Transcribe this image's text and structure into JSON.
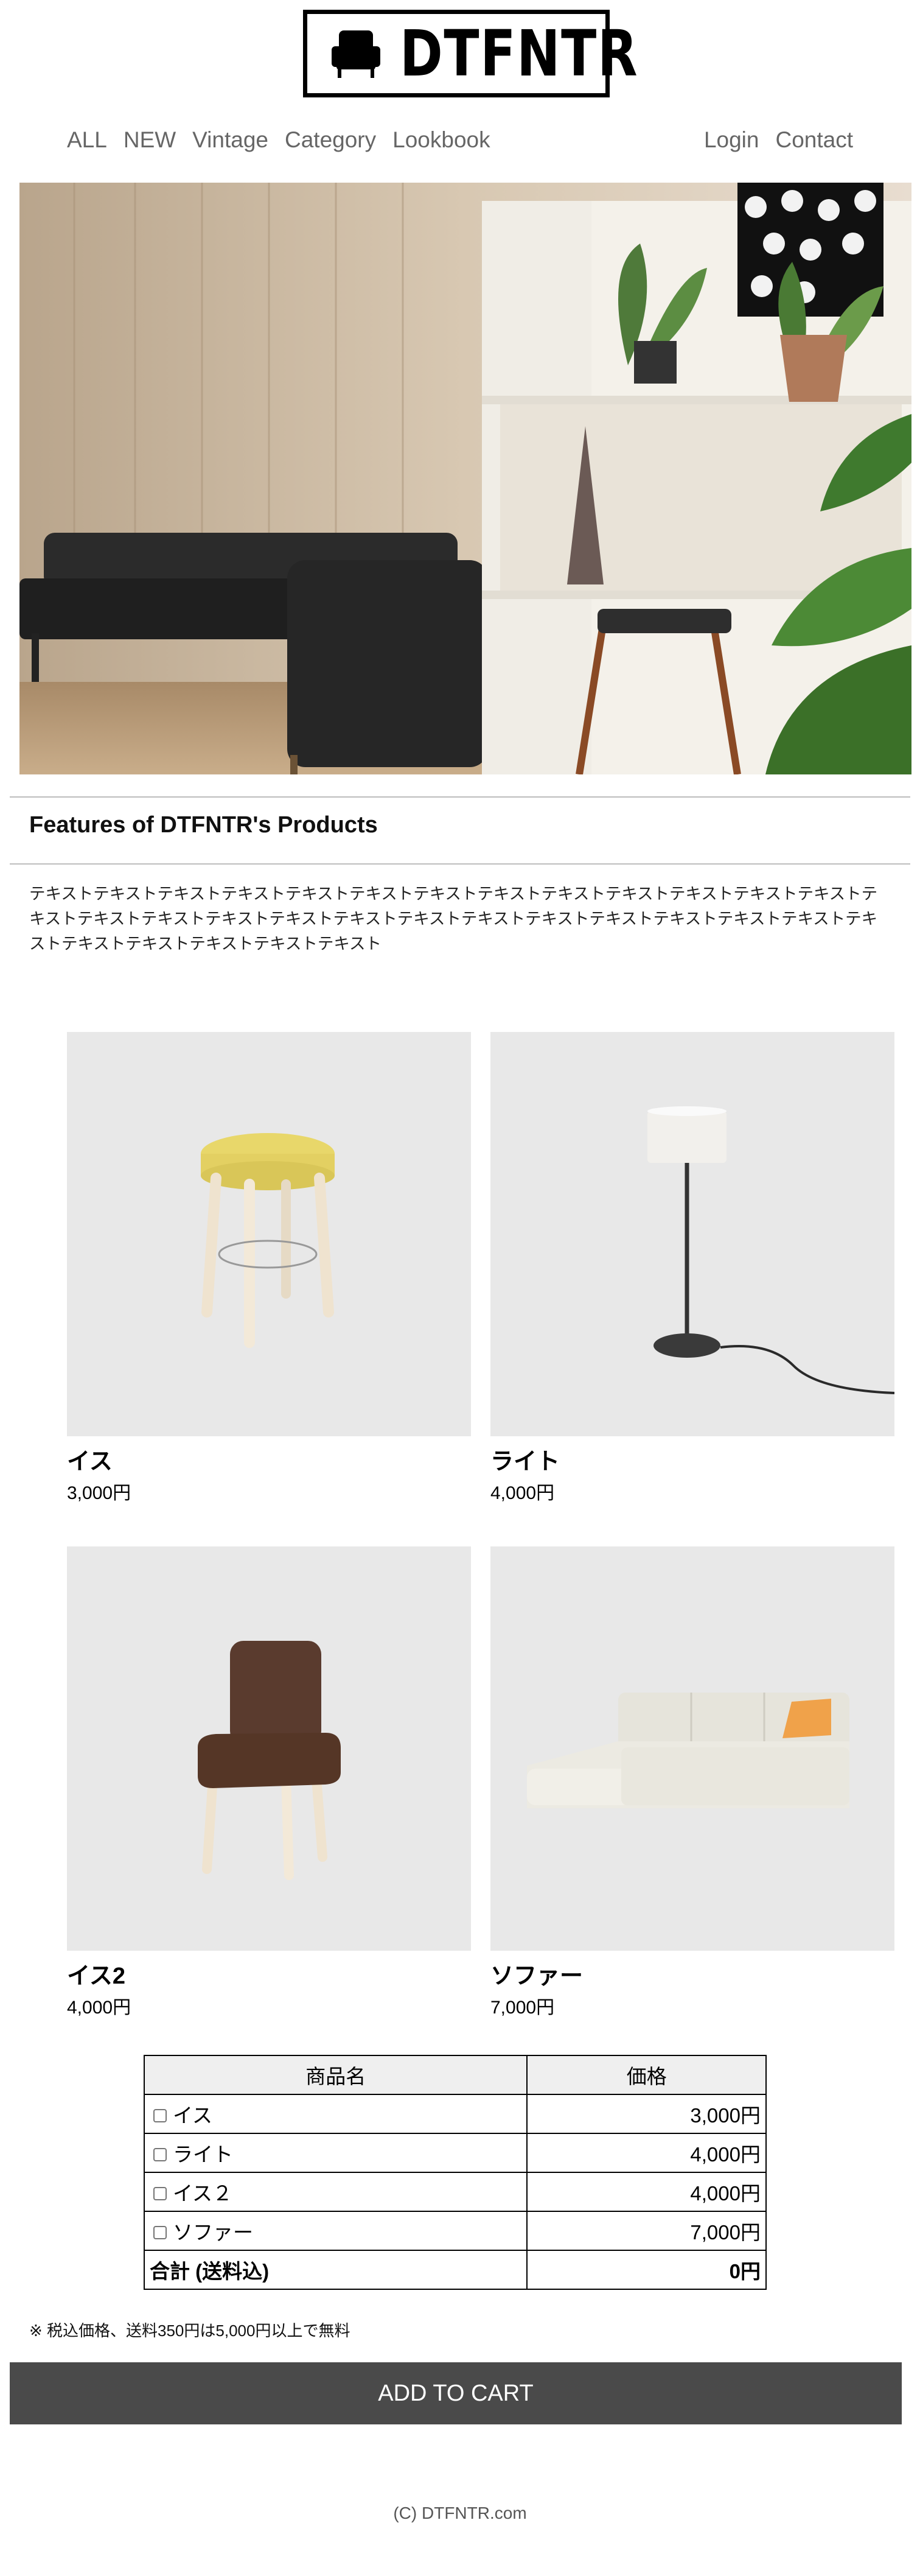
{
  "brand": {
    "name": "DTFNTR",
    "logo_icon": "armchair-icon"
  },
  "nav": {
    "left": [
      "ALL",
      "NEW",
      "Vintage",
      "Category",
      "Lookbook"
    ],
    "right": [
      "Login",
      "Contact"
    ]
  },
  "features": {
    "title": "Features of DTFNTR's Products",
    "body": "テキストテキストテキストテキストテキストテキストテキストテキストテキストテキストテキストテキストテキストテキストテキストテキストテキストテキストテキストテキストテキストテキストテキストテキストテキストテキストテキストテキストテキストテキストテキストテキスト"
  },
  "products": [
    {
      "name": "イス",
      "price": "3,000円"
    },
    {
      "name": "ライト",
      "price": "4,000円"
    },
    {
      "name": "イス2",
      "price": "4,000円"
    },
    {
      "name": "ソファー",
      "price": "7,000円"
    }
  ],
  "table": {
    "headers": [
      "商品名",
      "価格"
    ],
    "rows": [
      {
        "item": "イス",
        "price": "3,000円",
        "checked": false
      },
      {
        "item": "ライト",
        "price": "4,000円",
        "checked": false
      },
      {
        "item": "イス２",
        "price": "4,000円",
        "checked": false
      },
      {
        "item": "ソファー",
        "price": "7,000円",
        "checked": false
      }
    ],
    "total_label": "合計 (送料込)",
    "total_value": "0円"
  },
  "note": "※ 税込価格、送料350円は5,000円以上で無料",
  "cart_button": "ADD TO CART",
  "footer": "(C) DTFNTR.com",
  "colors": {
    "button_bg": "#4a4a4a",
    "nav_text": "#666666",
    "product_bg": "#e8e8e8"
  }
}
